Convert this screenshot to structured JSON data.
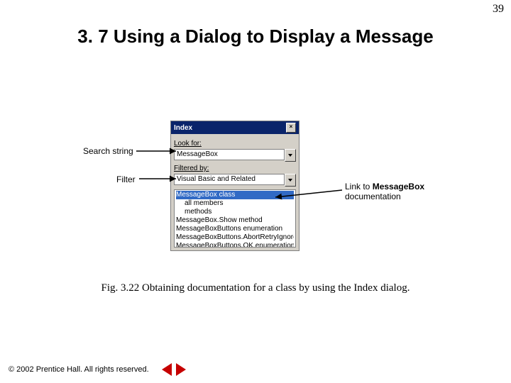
{
  "page_number": "39",
  "heading": "3. 7 Using a Dialog to Display a Message",
  "dialog": {
    "title": "Index",
    "label_lookfor": "Look for:",
    "value_lookfor": "MessageBox",
    "label_filter": "Filtered by:",
    "value_filter": "Visual Basic and Related",
    "results": {
      "r0": "MessageBox class",
      "r1": "all members",
      "r2": "methods",
      "r3": "MessageBox.Show method",
      "r4": "MessageBoxButtons enumeration",
      "r5": "MessageBoxButtons.AbortRetryIgnore enu",
      "r6": "MessageBoxButtons.OK enumeration mem"
    }
  },
  "callouts": {
    "search": "Search string",
    "filter": "Filter",
    "link_a": "Link to ",
    "link_b": "MessageBox",
    "link_c": "documentation"
  },
  "caption": "Fig. 3.22    Obtaining documentation for a class by using the Index dialog.",
  "footer": "© 2002 Prentice Hall.  All rights reserved."
}
